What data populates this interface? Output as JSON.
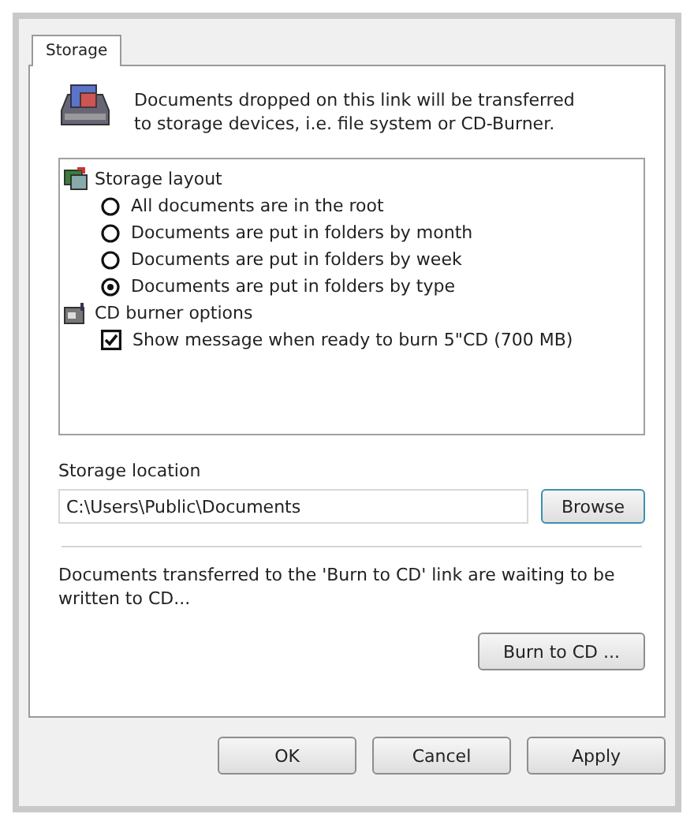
{
  "tabs": [
    {
      "label": "Storage",
      "selected": true
    }
  ],
  "description": "Documents dropped on this link will be transferred to storage devices, i.e. file system or CD-Burner.",
  "tree": [
    {
      "kind": "group",
      "label": "Storage layout",
      "children": [
        {
          "kind": "radio",
          "label": "All documents are in the root",
          "selected": false
        },
        {
          "kind": "radio",
          "label": "Documents are put in folders by month",
          "selected": false
        },
        {
          "kind": "radio",
          "label": "Documents are put in folders by week",
          "selected": false
        },
        {
          "kind": "radio",
          "label": "Documents are put in folders by type",
          "selected": true
        }
      ]
    },
    {
      "kind": "group",
      "label": "CD burner options",
      "children": [
        {
          "kind": "checkbox",
          "label": "Show message when ready to burn 5\"CD (700 MB)",
          "checked": true
        }
      ]
    }
  ],
  "storage_location": {
    "label": "Storage location",
    "value": "C:\\Users\\Public\\Documents",
    "browse": "Browse"
  },
  "burn_note": "Documents transferred to the 'Burn to CD' link are waiting to be written to CD...",
  "burn_button": "Burn to CD ...",
  "buttons": [
    "OK",
    "Cancel",
    "Apply"
  ]
}
